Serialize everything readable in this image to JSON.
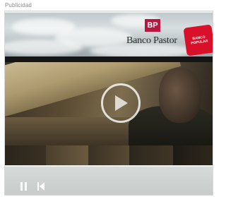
{
  "ad_label": "Publicidad",
  "banner": {
    "logo_letters": "BP",
    "bank_name": "Banco Pastor",
    "second_logo_line1": "BANCO",
    "second_logo_line2": "POPULAR"
  },
  "video": {
    "play_icon": "play-icon",
    "controls": {
      "pause_icon": "pause-icon",
      "rewind_icon": "rewind-icon"
    }
  },
  "colors": {
    "brand_red": "#b8163e",
    "popular_red": "#d9102a"
  }
}
